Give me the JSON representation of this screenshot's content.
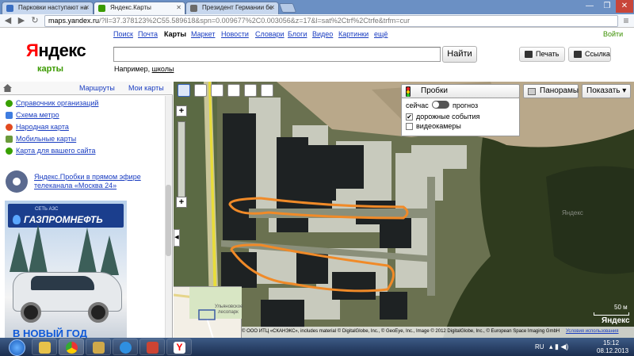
{
  "browser": {
    "tabs": [
      {
        "title": "Парковки наступают на",
        "active": false,
        "favicon_color": "#3a6ec2"
      },
      {
        "title": "Яндекс.Карты",
        "active": true,
        "favicon_color": "#3a9a00"
      },
      {
        "title": "Президент Германии бе",
        "active": false,
        "favicon_color": "#6b6b6b"
      }
    ],
    "url_host": "maps.yandex.ru",
    "url_rest": "/?ll=37.378123%2C55.589618&spn=0.009677%2C0.003056&z=17&l=sat%2Ctrf%2Ctrfe&trfm=cur"
  },
  "header": {
    "services": [
      {
        "label": "Поиск",
        "current": false
      },
      {
        "label": "Почта",
        "current": false
      },
      {
        "label": "Карты",
        "current": true
      },
      {
        "label": "Маркет",
        "current": false
      },
      {
        "label": "Новости",
        "current": false
      },
      {
        "label": "Словари",
        "current": false
      },
      {
        "label": "Блоги",
        "current": false
      },
      {
        "label": "Видео",
        "current": false
      },
      {
        "label": "Картинки",
        "current": false
      },
      {
        "label": "ещё",
        "current": false
      }
    ],
    "login": "Войти",
    "logo_ya": "Я",
    "logo_rest": "ндекс",
    "logo_sub": "карты",
    "search_value": "",
    "find_label": "Найти",
    "example_prefix": "Например,",
    "example_link": "школы",
    "print_label": "Печать",
    "link_label": "Ссылка"
  },
  "sidebar": {
    "tab_routes": "Маршруты",
    "tab_mymaps": "Мои карты",
    "items": [
      {
        "label": "Справочник организаций"
      },
      {
        "label": "Схема метро"
      },
      {
        "label": "Народная карта"
      },
      {
        "label": "Мобильные карты"
      },
      {
        "label": "Карта для вашего сайта"
      }
    ],
    "promo_text": "Яндекс.Пробки в прямом эфире телеканала «Москва 24»",
    "ad": {
      "brand_small": "СЕТЬ АЗС",
      "brand": "ГАЗПРОМНЕФТЬ",
      "bottom_text": "В НОВЫЙ ГОД"
    }
  },
  "map": {
    "traffic_label": "Пробки",
    "traffic_now": "сейчас",
    "traffic_forecast": "прогноз",
    "road_events": "дорожные события",
    "road_events_checked": true,
    "cameras": "видеокамеры",
    "cameras_checked": false,
    "panoramas_label": "Панорамы",
    "show_label": "Показать",
    "scale_label": "50 м",
    "minimap_label_1": "Ульяновское",
    "minimap_label_2": "лесопарк",
    "yandex_mark": "Яндекс",
    "copyright": "© ООО ИТЦ «СКАНЭКС», includes material © DigitalGlobe, Inc., © GeoEye, Inc., Image © 2012 DigitalGlobe, Inc., © European Space Imaging GmbH",
    "terms_link": "Условия использования"
  },
  "taskbar": {
    "lang": "RU",
    "time": "15:12",
    "date": "08.12.2013"
  },
  "colors": {
    "link": "#1a3dc1",
    "yandex_red": "#ff0000",
    "maps_green": "#3b9a00",
    "route_orange": "#f08a28",
    "ad_blue": "#1b3e8d"
  }
}
